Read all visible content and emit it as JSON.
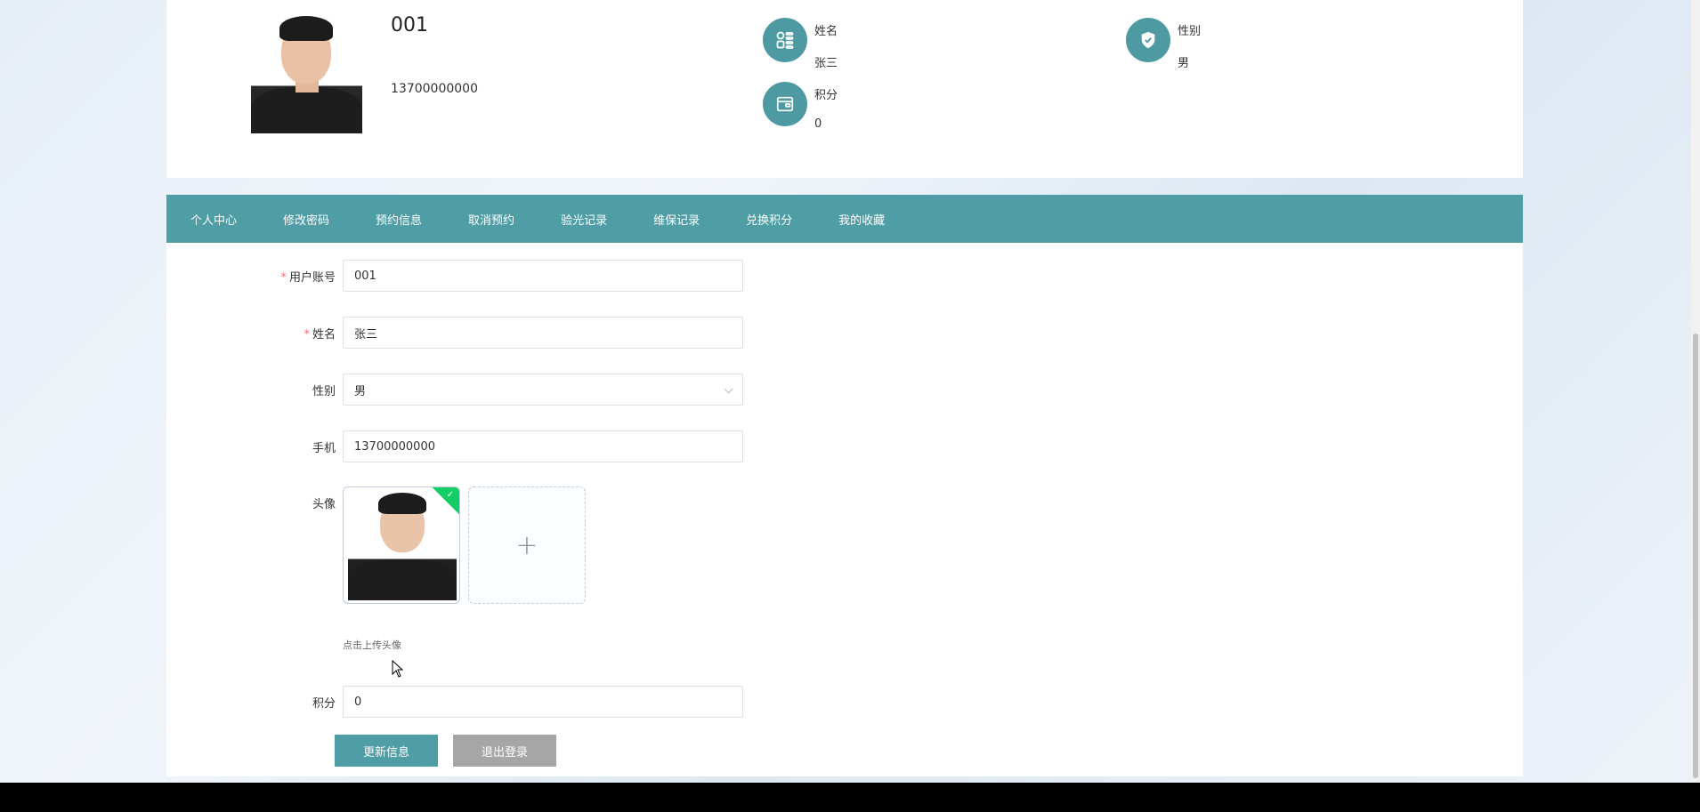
{
  "profile": {
    "account": "001",
    "phone": "13700000000",
    "name_label": "姓名",
    "name_value": "张三",
    "gender_label": "性别",
    "gender_value": "男",
    "points_label": "积分",
    "points_value": "0"
  },
  "nav": {
    "items": [
      "个人中心",
      "修改密码",
      "预约信息",
      "取消预约",
      "验光记录",
      "维保记录",
      "兑换积分",
      "我的收藏"
    ],
    "active": "个人中心"
  },
  "form": {
    "account_label": "用户账号",
    "account_value": "001",
    "name_label": "姓名",
    "name_value": "张三",
    "gender_label": "性别",
    "gender_value": "男",
    "phone_label": "手机",
    "phone_value": "13700000000",
    "avatar_label": "头像",
    "upload_tip": "点击上传头像",
    "upload_add_symbol": "+",
    "points_label": "积分",
    "points_value": "0",
    "required_mark": "*"
  },
  "buttons": {
    "update": "更新信息",
    "logout": "退出登录"
  },
  "colors": {
    "accent": "#4f9ea6",
    "upload_success": "#13ce66",
    "logout_button": "#a6a6a6"
  }
}
